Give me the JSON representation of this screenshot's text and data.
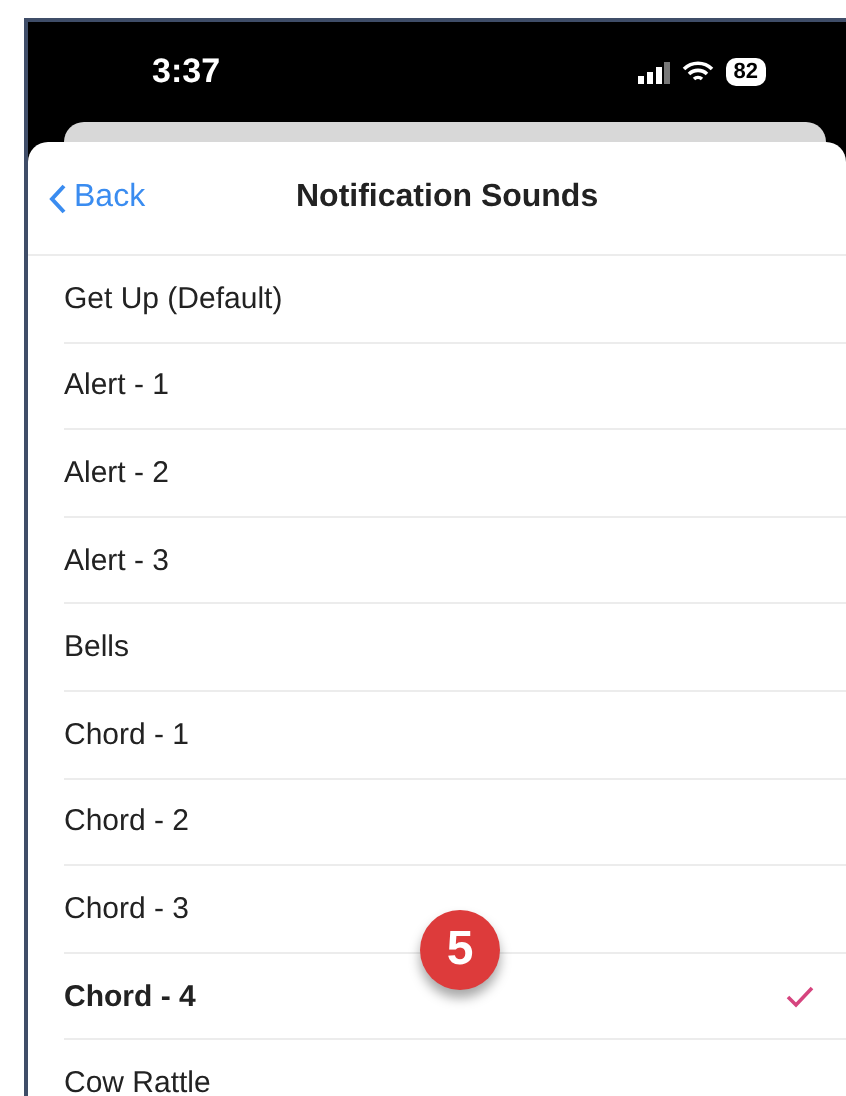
{
  "status_bar": {
    "time": "3:37",
    "battery": "82"
  },
  "nav": {
    "back": "Back",
    "title": "Notification Sounds"
  },
  "sounds": [
    {
      "name": "Get Up (Default)",
      "selected": false
    },
    {
      "name": "Alert - 1",
      "selected": false
    },
    {
      "name": "Alert - 2",
      "selected": false
    },
    {
      "name": "Alert - 3",
      "selected": false
    },
    {
      "name": "Bells",
      "selected": false
    },
    {
      "name": "Chord - 1",
      "selected": false
    },
    {
      "name": "Chord - 2",
      "selected": false
    },
    {
      "name": "Chord - 3",
      "selected": false
    },
    {
      "name": "Chord - 4",
      "selected": true
    },
    {
      "name": "Cow Rattle",
      "selected": false
    }
  ],
  "annotation": {
    "label": "5"
  }
}
